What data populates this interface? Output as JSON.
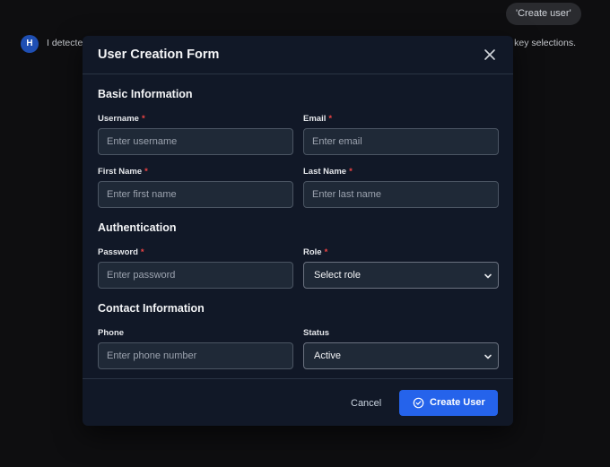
{
  "chat": {
    "user_message": "'Create user'",
    "assistant_avatar_letter": "H",
    "assistant_text_start": "I detected",
    "assistant_text_end": "n key selections."
  },
  "modal": {
    "title": "User Creation Form",
    "close_icon": "close-icon",
    "sections": {
      "basic": "Basic Information",
      "auth": "Authentication",
      "contact": "Contact Information"
    },
    "fields": {
      "username": {
        "label": "Username",
        "required": "*",
        "placeholder": "Enter username"
      },
      "email": {
        "label": "Email",
        "required": "*",
        "placeholder": "Enter email"
      },
      "first_name": {
        "label": "First Name",
        "required": "*",
        "placeholder": "Enter first name"
      },
      "last_name": {
        "label": "Last Name",
        "required": "*",
        "placeholder": "Enter last name"
      },
      "password": {
        "label": "Password",
        "required": "*",
        "placeholder": "Enter password"
      },
      "role": {
        "label": "Role",
        "required": "*",
        "value": "Select role"
      },
      "phone": {
        "label": "Phone",
        "placeholder": "Enter phone number"
      },
      "status": {
        "label": "Status",
        "value": "Active"
      }
    },
    "footer": {
      "cancel_label": "Cancel",
      "create_label": "Create User",
      "create_icon": "check-circle-icon"
    }
  },
  "colors": {
    "accent": "#2563eb",
    "required": "#ef4444",
    "modal_bg": "#111827",
    "input_bg": "#1f2937"
  }
}
